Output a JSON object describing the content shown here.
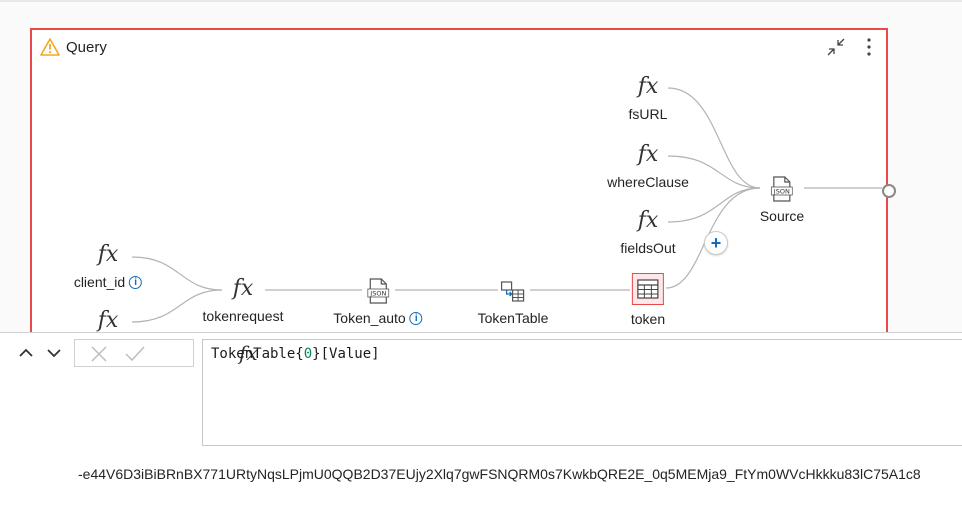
{
  "query": {
    "title": "Query",
    "icons": {
      "warning": "warning-icon",
      "collapse": "collapse-icon",
      "more": "more-vertical-icon"
    }
  },
  "nodes": {
    "fsURL": {
      "label": "fsURL",
      "icon": "fx-icon"
    },
    "whereClause": {
      "label": "whereClause",
      "icon": "fx-icon"
    },
    "fieldsOut": {
      "label": "fieldsOut",
      "icon": "fx-icon"
    },
    "source": {
      "label": "Source",
      "icon": "json-file-icon"
    },
    "client_id": {
      "label": "client_id",
      "icon": "fx-icon",
      "has_info": true
    },
    "unnamed_fx": {
      "icon": "fx-icon"
    },
    "tokenrequest": {
      "label": "tokenrequest",
      "icon": "fx-icon"
    },
    "token_auto": {
      "label": "Token_auto",
      "icon": "json-file-icon",
      "has_info": true
    },
    "tokentable": {
      "label": "TokenTable",
      "icon": "table-transform-icon"
    },
    "token": {
      "label": "token",
      "icon": "table-icon",
      "selected": true
    }
  },
  "formula_bar": {
    "fx_symbol": "fx",
    "formula_prefix": "TokenTable{",
    "formula_index": "0",
    "formula_suffix": "}[Value]"
  },
  "result": {
    "value": "-e44V6D3iBiBRnBX771URtyNqsLPjmU0QQB2D37EUjy2Xlq7gwFSNQRM0s7KwkbQRE2E_0q5MEMja9_FtYm0WVcHkkku83lC75A1c8"
  },
  "colors": {
    "accent": "#0f6cbd",
    "error_border": "#e84a4a",
    "warning": "#f5a623"
  }
}
